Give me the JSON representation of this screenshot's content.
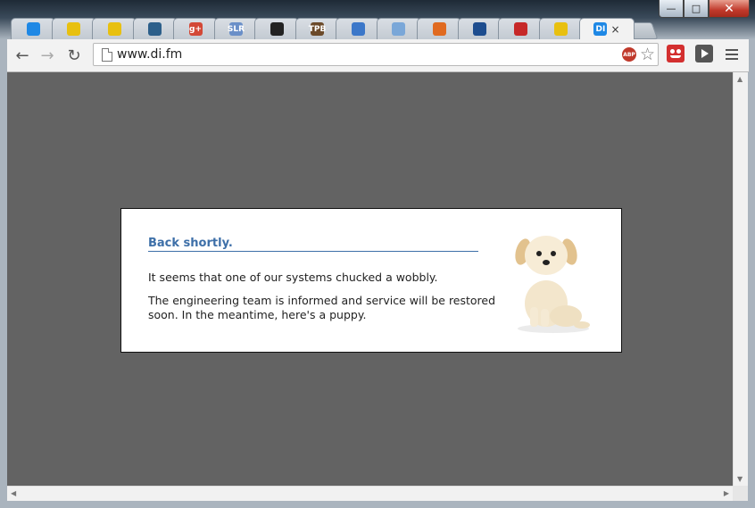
{
  "browser": {
    "address_bar": {
      "url": "www.di.fm"
    },
    "tabs": [
      {
        "icon": "world-globe-icon",
        "color": "#1e88e5"
      },
      {
        "icon": "yellow-box-icon",
        "color": "#e8c010"
      },
      {
        "icon": "yellow-box-icon",
        "color": "#e8c010"
      },
      {
        "icon": "checkmark-box-icon",
        "color": "#2c5f8a"
      },
      {
        "icon": "google-plus-icon",
        "color": "#d34836",
        "text": "g+"
      },
      {
        "icon": "slr-icon",
        "color": "#6a8fc8",
        "text": "SLR"
      },
      {
        "icon": "dark-s-icon",
        "color": "#222222"
      },
      {
        "icon": "tpb-icon",
        "color": "#6b4a2a",
        "text": "TPB"
      },
      {
        "icon": "blue-triangle-icon",
        "color": "#3b77c9"
      },
      {
        "icon": "ticket-icon",
        "color": "#7aa7d8"
      },
      {
        "icon": "network-nodes-icon",
        "color": "#e06a20"
      },
      {
        "icon": "bookmark-box-icon",
        "color": "#1d4d8f"
      },
      {
        "icon": "play-circle-icon",
        "color": "#c62828"
      },
      {
        "icon": "hand-icon",
        "color": "#e8c010"
      },
      {
        "icon": "di-logo-icon",
        "color": "#1e88e5",
        "text": "DI",
        "active": true
      }
    ],
    "extensions": {
      "adblock_label": "ABP"
    }
  },
  "page": {
    "heading": "Back shortly.",
    "message_1": "It seems that one of our systems chucked a wobbly.",
    "message_2": "The engineering team is informed and service will be restored soon. In the meantime, here's a puppy.",
    "puppy_alt": "puppy"
  },
  "colors": {
    "page_background": "#636363",
    "heading_color": "#3d6fa8",
    "card_background": "#ffffff"
  }
}
